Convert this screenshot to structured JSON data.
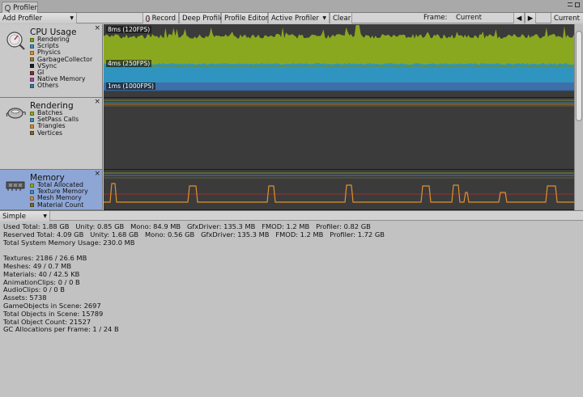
{
  "window": {
    "tab_title": "Profiler",
    "icons": {
      "tab": "profiler-icon",
      "menu": "window-menu-icon",
      "maximize": "maximize-icon"
    }
  },
  "toolbar": {
    "add_profiler": "Add Profiler",
    "record": "Record",
    "deep_profile": "Deep Profile",
    "profile_editor": "Profile Editor",
    "active_profiler": "Active Profiler",
    "clear": "Clear",
    "frame_label": "Frame:",
    "frame_value": "Current",
    "current_button": "Current",
    "dropdown_glyph": "▼",
    "prev_glyph": "◀",
    "next_glyph": "▶"
  },
  "panels": [
    {
      "title": "CPU Usage",
      "icon": "cpu-gauge-icon",
      "close_glyph": "×",
      "legend": [
        {
          "label": "Rendering",
          "color": "#7f9f1a"
        },
        {
          "label": "Scripts",
          "color": "#3d8eb9"
        },
        {
          "label": "Physics",
          "color": "#d78f2c"
        },
        {
          "label": "GarbageCollector",
          "color": "#9c7a3a"
        },
        {
          "label": "VSync",
          "color": "#1f1f1f"
        },
        {
          "label": "GI",
          "color": "#8a2e2e"
        },
        {
          "label": "Native Memory",
          "color": "#9c4ca0"
        },
        {
          "label": "Others",
          "color": "#3e78a8"
        }
      ],
      "graph_labels": [
        "8ms (120FPS)",
        "4ms (250FPS)",
        "1ms (1000FPS)"
      ]
    },
    {
      "title": "Rendering",
      "icon": "rendering-teapot-icon",
      "close_glyph": "×",
      "legend": [
        {
          "label": "Batches",
          "color": "#8fa82a"
        },
        {
          "label": "SetPass Calls",
          "color": "#3f8fb8"
        },
        {
          "label": "Triangles",
          "color": "#d48a2a"
        },
        {
          "label": "Vertices",
          "color": "#7a6a2a"
        }
      ]
    },
    {
      "title": "Memory",
      "icon": "memory-chip-icon",
      "close_glyph": "×",
      "selected": true,
      "legend": [
        {
          "label": "Total Allocated",
          "color": "#8fa82a"
        },
        {
          "label": "Texture Memory",
          "color": "#3f8fb8"
        },
        {
          "label": "Mesh Memory",
          "color": "#d48a2a"
        },
        {
          "label": "Material Count",
          "color": "#7a6a2a"
        }
      ]
    }
  ],
  "details": {
    "view_mode": "Simple",
    "lines": [
      "Used Total: 1.88 GB   Unity: 0.85 GB   Mono: 84.9 MB   GfxDriver: 135.3 MB   FMOD: 1.2 MB   Profiler: 0.82 GB",
      "Reserved Total: 4.09 GB   Unity: 1.68 GB   Mono: 0.56 GB   GfxDriver: 135.3 MB   FMOD: 1.2 MB   Profiler: 1.72 GB",
      "Total System Memory Usage: 230.0 MB",
      "",
      "Textures: 2186 / 26.6 MB",
      "Meshes: 49 / 0.7 MB",
      "Materials: 40 / 42.5 KB",
      "AnimationClips: 0 / 0 B",
      "AudioClips: 0 / 0 B",
      "Assets: 5738",
      "GameObjects in Scene: 2697",
      "Total Objects in Scene: 15789",
      "Total Object Count: 21527",
      "GC Allocations per Frame: 1 / 24 B"
    ]
  }
}
